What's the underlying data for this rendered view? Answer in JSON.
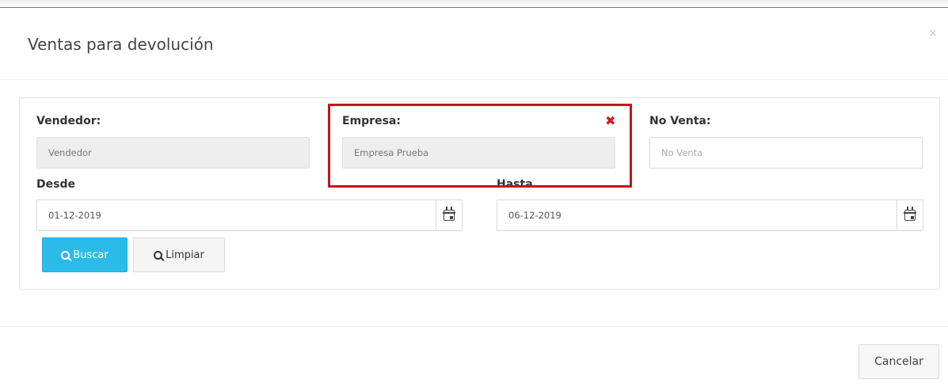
{
  "modal": {
    "title": "Ventas para devolución",
    "close_symbol": "×"
  },
  "filters": {
    "vendedor": {
      "label": "Vendedor:",
      "value": "Vendedor"
    },
    "empresa": {
      "label": "Empresa:",
      "value": "Empresa Prueba",
      "clear_symbol": "✖"
    },
    "no_venta": {
      "label": "No Venta:",
      "placeholder": "No Venta"
    },
    "desde": {
      "label": "Desde",
      "value": "01-12-2019",
      "icon": "calendar-icon"
    },
    "hasta": {
      "label": "Hasta",
      "value": "06-12-2019",
      "icon": "calendar-icon"
    }
  },
  "actions": {
    "buscar_label": "Buscar",
    "limpiar_label": "Limpiar",
    "search_icon": "search-icon"
  },
  "footer": {
    "cancelar_label": "Cancelar"
  },
  "colors": {
    "primary": "#2bbbe8",
    "highlight_border": "#c4151c",
    "clear_icon": "#d9161f"
  }
}
